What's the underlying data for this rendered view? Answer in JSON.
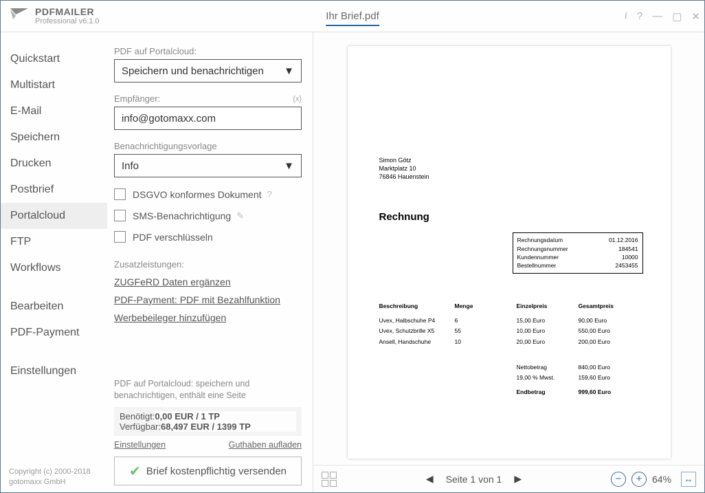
{
  "app": {
    "name": "PDFMAILER",
    "version": "Professional v6.1.0",
    "document": "Ihr Brief.pdf",
    "copyright_line1": "Copyright (c) 2000-2018",
    "copyright_line2": "gotomaxx GmbH"
  },
  "sidebar": {
    "items": [
      {
        "label": "Quickstart"
      },
      {
        "label": "Multistart"
      },
      {
        "label": "E-Mail"
      },
      {
        "label": "Speichern"
      },
      {
        "label": "Drucken"
      },
      {
        "label": "Postbrief"
      },
      {
        "label": "Portalcloud",
        "selected": true
      },
      {
        "label": "FTP"
      },
      {
        "label": "Workflows"
      },
      {
        "label": "Bearbeiten"
      },
      {
        "label": "PDF-Payment"
      },
      {
        "label": "Einstellungen"
      }
    ]
  },
  "form": {
    "portalcloud_label": "PDF auf Portalcloud:",
    "portalcloud_value": "Speichern und benachrichtigen",
    "recipient_label": "Empfänger:",
    "recipient_hint": "{x}",
    "recipient_value": "info@gotomaxx.com",
    "template_label": "Benachrichtigungsvorlage",
    "template_value": "Info",
    "chk_dsgvo": "DSGVO konformes Dokument",
    "chk_sms": "SMS-Benachrichtigung",
    "chk_encrypt": "PDF verschlüsseln",
    "extras_label": "Zusatzleistungen:",
    "link_zugferd": "ZUGFeRD Daten ergänzen",
    "link_payment": "PDF-Payment: PDF mit Bezahlfunktion",
    "link_insert": "Werbebeileger hinzufügen",
    "summary": "PDF auf Portalcloud: speichern und benachrichtigen, enthält eine Seite",
    "needed_label": "Benötigt:",
    "needed_value": "0,00 EUR /        1 TP",
    "available_label": "Verfügbar:",
    "available_value": "68,497 EUR / 1399 TP",
    "link_settings": "Einstellungen",
    "link_topup": "Guthaben aufladen",
    "send_label": "Brief kostenpflichtig versenden"
  },
  "preview": {
    "addr": {
      "name": "Simon Götz",
      "street": "Marktplatz 10",
      "city": "76846 Hauenstein"
    },
    "title": "Rechnung",
    "meta": {
      "date_lbl": "Rechnungsdatum",
      "date_val": "01.12.2016",
      "no_lbl": "Rechnungsnummer",
      "no_val": "184541",
      "cust_lbl": "Kundennummer",
      "cust_val": "10000",
      "order_lbl": "Bestellnummer",
      "order_val": "2453455"
    },
    "headers": {
      "c1": "Beschreibung",
      "c2": "Menge",
      "c3": "Einzelpreis",
      "c4": "Gesamtpreis"
    },
    "rows": [
      {
        "c1": "Uvex, Halbschuhe P4",
        "c2": "6",
        "c3": "15,00 Euro",
        "c4": "90,00 Euro"
      },
      {
        "c1": "Uvex, Schutzbrille X5",
        "c2": "55",
        "c3": "10,00 Euro",
        "c4": "550,00 Euro"
      },
      {
        "c1": "Ansell, Handschuhe",
        "c2": "10",
        "c3": "20,00 Euro",
        "c4": "200,00 Euro"
      }
    ],
    "totals": {
      "net_lbl": "Nettobetrag",
      "net_val": "840,00 Euro",
      "vat_lbl": "19,00 % Mwst.",
      "vat_val": "159,60 Euro",
      "end_lbl": "Endbetrag",
      "end_val": "999,60 Euro"
    }
  },
  "footer": {
    "page_text": "Seite 1 von 1",
    "zoom": "64%"
  }
}
